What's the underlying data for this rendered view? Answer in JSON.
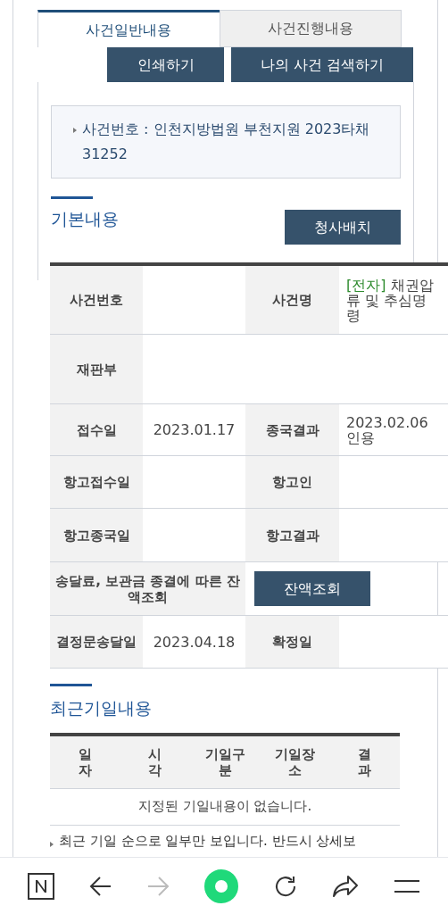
{
  "tabs": [
    {
      "label": "사건일반내용",
      "selected": true
    },
    {
      "label": "사건진행내용",
      "selected": false
    }
  ],
  "actions": [
    "인쇄하기",
    "나의 사건 검색하기"
  ],
  "case_box": {
    "text": "사건번호 : 인천지방법원 부천지원 2023타채31252"
  },
  "basic": {
    "title": "기본내용",
    "button": "청사배치",
    "rows": [
      {
        "kind": "pair",
        "cells": [
          {
            "label": "사건번호"
          },
          {
            "label": "사건명",
            "tag": "[전자]",
            "value": " 채권압류 및 추심명령"
          }
        ]
      },
      {
        "kind": "single",
        "cells": [
          {
            "label": "재판부"
          }
        ]
      },
      {
        "kind": "pair",
        "cells": [
          {
            "label": "접수일",
            "value": "2023.01.17"
          },
          {
            "label": "종국결과",
            "value": "2023.02.06 인용"
          }
        ]
      },
      {
        "kind": "pair",
        "cells": [
          {
            "label": "항고접수일"
          },
          {
            "label": "항고인"
          }
        ]
      },
      {
        "kind": "pair",
        "cells": [
          {
            "label": "항고종국일"
          },
          {
            "label": "항고결과"
          }
        ]
      },
      {
        "kind": "button",
        "label": "송달료, 보관금 종결에 따른 잔액조회",
        "button": "잔액조회"
      },
      {
        "kind": "pair",
        "cells": [
          {
            "label": "결정문송달일",
            "value": "2023.04.18"
          },
          {
            "label": "확정일"
          }
        ]
      }
    ]
  },
  "recent": {
    "title": "최근기일내용",
    "columns": [
      "일자",
      "시각",
      "기일구분",
      "기일장소",
      "결과"
    ],
    "empty": "지정된 기일내용이 없습니다.",
    "note": "최근 기일 순으로 일부만 보입니다. 반드시 상세보"
  }
}
